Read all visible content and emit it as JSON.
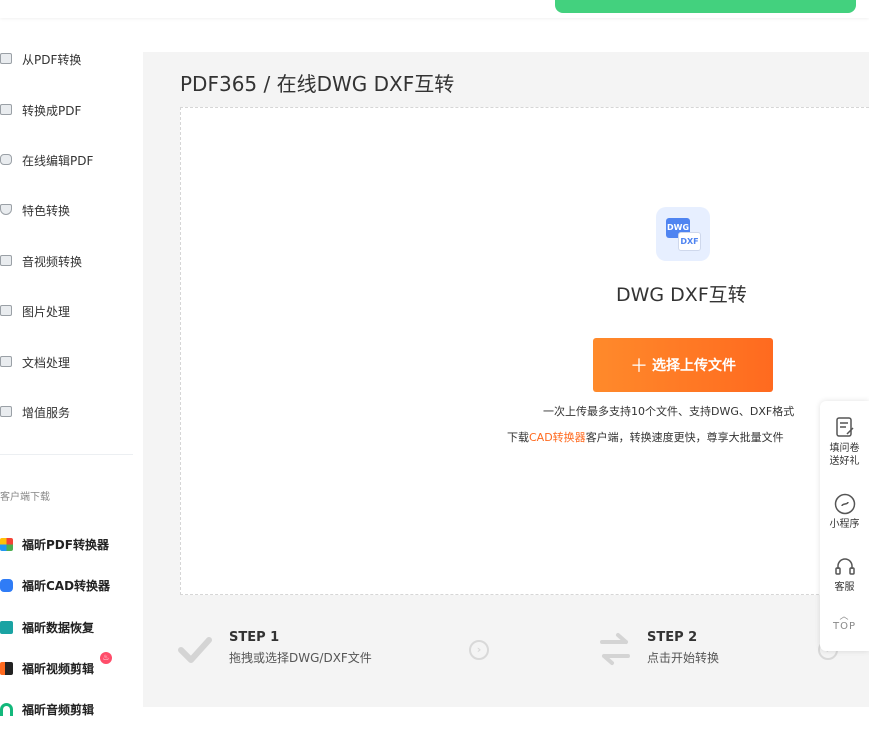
{
  "sidebar": {
    "nav_items": [
      {
        "label": "从PDF转换",
        "icon": "pdf-convert-icon"
      },
      {
        "label": "转换成PDF",
        "icon": "to-pdf-icon"
      },
      {
        "label": "在线编辑PDF",
        "icon": "edit-pdf-icon"
      },
      {
        "label": "特色转换",
        "icon": "special-convert-icon"
      },
      {
        "label": "音视频转换",
        "icon": "media-convert-icon"
      },
      {
        "label": "图片处理",
        "icon": "image-icon"
      },
      {
        "label": "文档处理",
        "icon": "document-icon"
      },
      {
        "label": "增值服务",
        "icon": "service-icon"
      }
    ],
    "client_section_title": "客户端下载",
    "client_items": [
      {
        "label": "福昕PDF转换器",
        "color": "#4caf50"
      },
      {
        "label": "福昕CAD转换器",
        "color": "#2f7cf6"
      },
      {
        "label": "福昕数据恢复",
        "color": "#1aa3a3"
      },
      {
        "label": "福昕视频剪辑",
        "color": "#ff6a1f"
      },
      {
        "label": "福昕音频剪辑",
        "color": "#13b87b"
      }
    ],
    "hot_badge": "♨"
  },
  "main": {
    "breadcrumb": "PDF365 / 在线DWG DXF互转",
    "tool_icon": {
      "top_text": "DWG",
      "bottom_text": "DXF"
    },
    "tool_name": "DWG DXF互转",
    "upload_button": "选择上传文件",
    "info_line1": "一次上传最多支持10个文件、支持DWG、DXF格式",
    "info_line2_prefix": "下载",
    "info_line2_link": "CAD转换器",
    "info_line2_suffix": "客户端，转换速度更快，尊享大批量文件"
  },
  "steps": [
    {
      "title": "STEP 1",
      "desc": "拖拽或选择DWG/DXF文件"
    },
    {
      "title": "STEP 2",
      "desc": "点击开始转换"
    }
  ],
  "float_panel": {
    "survey_line1": "填问卷",
    "survey_line2": "送好礼",
    "mini_program": "小程序",
    "customer_service": "客服",
    "top": "TOP"
  },
  "colors": {
    "accent": "#ff6a1f",
    "toast": "#43d17e",
    "icon_blue": "#4f84f1"
  }
}
